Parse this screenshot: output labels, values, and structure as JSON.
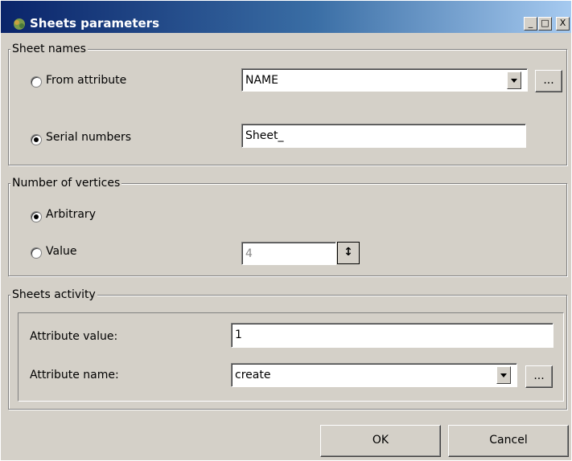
{
  "window": {
    "title": "Sheets parameters",
    "minimize_label": "_",
    "maximize_label": "□",
    "close_label": "X"
  },
  "sheet_names": {
    "group_title": "Sheet names",
    "from_attribute_label": "From attribute",
    "from_attribute_value": "NAME",
    "from_attribute_selected": false,
    "browse_label": "...",
    "serial_numbers_label": "Serial numbers",
    "serial_numbers_value": "Sheet_",
    "serial_numbers_selected": true
  },
  "vertices": {
    "group_title": "Number of vertices",
    "arbitrary_label": "Arbitrary",
    "arbitrary_selected": true,
    "value_label": "Value",
    "value_selected": false,
    "value_field": "4",
    "spin_label": "↕"
  },
  "activity": {
    "group_title": "Sheets activity",
    "attr_value_label": "Attribute value:",
    "attr_value": "1",
    "attr_name_label": "Attribute name:",
    "attr_name": "create",
    "browse_label": "..."
  },
  "buttons": {
    "ok": "OK",
    "cancel": "Cancel"
  }
}
